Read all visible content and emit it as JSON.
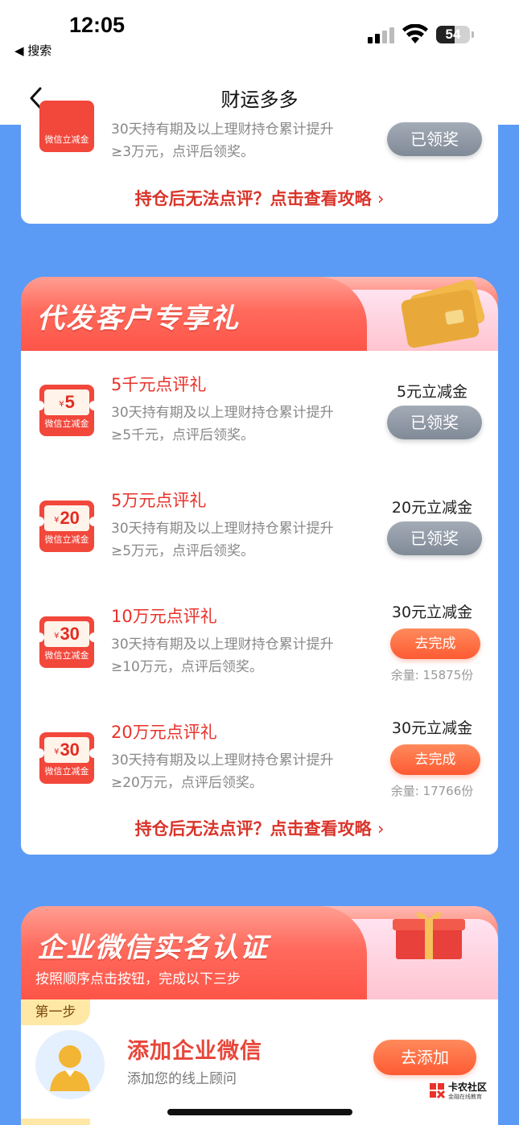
{
  "status_bar": {
    "time": "12:05",
    "back_app": "◀ 搜索",
    "battery": "54"
  },
  "nav": {
    "title": "财运多多"
  },
  "top_card": {
    "partial_coupon_label": "微信立减金",
    "desc_line1": "30天持有期及以上理财持仓累计提升",
    "desc_line2": "≥3万元，点评后领奖。",
    "button": "已领奖",
    "guide_link": "持仓后无法点评？点击查看攻略",
    "guide_chevron": "›"
  },
  "section_daifa": {
    "title": "代发客户专享礼",
    "items": [
      {
        "coupon_currency": "¥",
        "coupon_amount": "5",
        "coupon_label": "微信立减金",
        "title": "5千元点评礼",
        "desc_line1": "30天持有期及以上理财持仓累计提升",
        "desc_line2": "≥5千元，点评后领奖。",
        "reward": "5元立减金",
        "button": "已领奖",
        "stock": ""
      },
      {
        "coupon_currency": "¥",
        "coupon_amount": "20",
        "coupon_label": "微信立减金",
        "title": "5万元点评礼",
        "desc_line1": "30天持有期及以上理财持仓累计提升",
        "desc_line2": "≥5万元，点评后领奖。",
        "reward": "20元立减金",
        "button": "已领奖",
        "stock": ""
      },
      {
        "coupon_currency": "¥",
        "coupon_amount": "30",
        "coupon_label": "微信立减金",
        "title": "10万元点评礼",
        "desc_line1": "30天持有期及以上理财持仓累计提升",
        "desc_line2": "≥10万元，点评后领奖。",
        "reward": "30元立减金",
        "button": "去完成",
        "stock": "余量: 15875份"
      },
      {
        "coupon_currency": "¥",
        "coupon_amount": "30",
        "coupon_label": "微信立减金",
        "title": "20万元点评礼",
        "desc_line1": "30天持有期及以上理财持仓累计提升",
        "desc_line2": "≥20万元，点评后领奖。",
        "reward": "30元立减金",
        "button": "去完成",
        "stock": "余量: 17766份"
      }
    ],
    "guide_link": "持仓后无法点评？点击查看攻略",
    "guide_chevron": "›"
  },
  "section_wecom": {
    "title": "企业微信实名认证",
    "subtitle": "按照顺序点击按钮，完成以下三步",
    "step1": {
      "tag": "第一步",
      "title": "添加企业微信",
      "desc": "添加您的线上顾问",
      "button": "去添加"
    }
  },
  "watermark": {
    "name": "卡农社区",
    "sub": "金融在线教育"
  },
  "colors": {
    "page_bg": "#5b9bf5",
    "accent_red": "#e8322a",
    "button_orange": "#fd5a32",
    "button_gray": "#8d96a2"
  }
}
